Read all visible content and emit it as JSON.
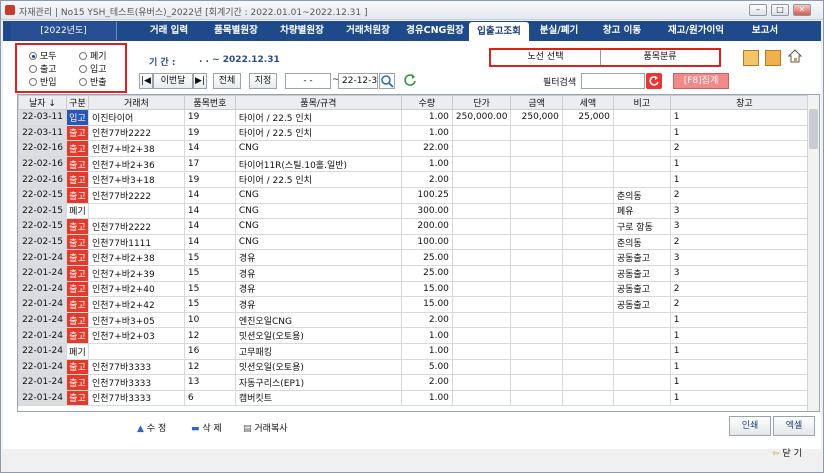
{
  "titlebar": {
    "title": "자재관리 | No15 YSH_테스트(유버스)_2022년 [회계기간 : 2022.01.01~2022.12.31 ]"
  },
  "menubar": {
    "year": "[2022년도]",
    "items": [
      "거래 입력",
      "품목별원장",
      "차량별원장",
      "거래처원장",
      "경유CNG원장",
      "입출고조회",
      "분실/폐기",
      "창고 이동",
      "재고/원가이익",
      "보고서"
    ],
    "active": "입출고조회"
  },
  "filter": {
    "options": [
      "모두",
      "폐기",
      "출고",
      "입고",
      "반입",
      "반출"
    ],
    "selected": "모두"
  },
  "period": {
    "label": "기 간 :",
    "value": ". .   ~ 2022.12.31"
  },
  "select": {
    "route": "노선 선택",
    "category": "품목분류"
  },
  "toolbar": {
    "first": "|◀",
    "prev": "이번달",
    "next": "▶|",
    "all": "전체",
    "set": "지정",
    "date_from": "- -",
    "date_to": "22-12-31",
    "filter_label": "필터검색",
    "filter_value": "",
    "sum": "[F8]집계"
  },
  "table": {
    "headers": [
      "날자 ↓",
      "구분",
      "거래처",
      "품목번호",
      "품목/규격",
      "수량",
      "단가",
      "금액",
      "세액",
      "비고",
      "창고"
    ],
    "rows": [
      [
        "22-03-11",
        "입고",
        "이진타이어",
        "19",
        "타이어 / 22.5 인치",
        "1.00",
        "250,000.00",
        "250,000",
        "25,000",
        "",
        "1"
      ],
      [
        "22-03-11",
        "출고",
        "인천77바2222",
        "19",
        "타이어 / 22.5 인치",
        "1.00",
        "",
        "",
        "",
        "",
        "1"
      ],
      [
        "22-02-16",
        "출고",
        "인천7+바2+38",
        "14",
        "CNG",
        "22.00",
        "",
        "",
        "",
        "",
        "2"
      ],
      [
        "22-02-16",
        "출고",
        "인천7+바2+36",
        "17",
        "타이어11R(스틸.10홀.일반)",
        "1.00",
        "",
        "",
        "",
        "",
        "1"
      ],
      [
        "22-02-16",
        "출고",
        "인천7+바3+18",
        "19",
        "타이어 / 22.5 인치",
        "2.00",
        "",
        "",
        "",
        "",
        "1"
      ],
      [
        "22-02-15",
        "출고",
        "인천77바2222",
        "14",
        "CNG",
        "100.25",
        "",
        "",
        "",
        "춘의동",
        "2"
      ],
      [
        "22-02-15",
        "폐기",
        "",
        "14",
        "CNG",
        "300.00",
        "",
        "",
        "",
        "폐유",
        "3"
      ],
      [
        "22-02-15",
        "출고",
        "인천77바2222",
        "14",
        "CNG",
        "200.00",
        "",
        "",
        "",
        "구로 항동",
        "3"
      ],
      [
        "22-02-15",
        "출고",
        "인천77바1111",
        "14",
        "CNG",
        "100.00",
        "",
        "",
        "",
        "춘의동",
        "2"
      ],
      [
        "22-01-24",
        "출고",
        "인천7+바2+38",
        "15",
        "경유",
        "25.00",
        "",
        "",
        "",
        "공동출고",
        "3"
      ],
      [
        "22-01-24",
        "출고",
        "인천7+바2+39",
        "15",
        "경유",
        "25.00",
        "",
        "",
        "",
        "공동출고",
        "3"
      ],
      [
        "22-01-24",
        "출고",
        "인천7+바2+40",
        "15",
        "경유",
        "15.00",
        "",
        "",
        "",
        "공동출고",
        "2"
      ],
      [
        "22-01-24",
        "출고",
        "인천7+바2+42",
        "15",
        "경유",
        "15.00",
        "",
        "",
        "",
        "공동출고",
        "2"
      ],
      [
        "22-01-24",
        "출고",
        "인천7+바3+05",
        "10",
        "엔진오일CNG",
        "2.00",
        "",
        "",
        "",
        "",
        "1"
      ],
      [
        "22-01-24",
        "출고",
        "인천7+바2+03",
        "12",
        "밋션오일(오토용)",
        "1.00",
        "",
        "",
        "",
        "",
        "1"
      ],
      [
        "22-01-24",
        "폐기",
        "",
        "16",
        "고무패킹",
        "1.00",
        "",
        "",
        "",
        "",
        "1"
      ],
      [
        "22-01-24",
        "출고",
        "인천77바3333",
        "12",
        "밋션오일(오토용)",
        "5.00",
        "",
        "",
        "",
        "",
        "1"
      ],
      [
        "22-01-24",
        "출고",
        "인천77바3333",
        "13",
        "자동구리스(EP1)",
        "2.00",
        "",
        "",
        "",
        "",
        "1"
      ],
      [
        "22-01-24",
        "출고",
        "인천77바3333",
        "6",
        "캠버킷트",
        "1.00",
        "",
        "",
        "",
        "",
        "1"
      ]
    ]
  },
  "actions": {
    "edit": "수 정",
    "delete": "삭 제",
    "copy": "거래복사",
    "print": "인쇄",
    "excel": "엑셀",
    "close": "닫 기"
  },
  "colors": {
    "menubar": "#1e4a8c",
    "in": "#2a56b4",
    "out": "#e43a2a",
    "highlight": "#e02020"
  }
}
